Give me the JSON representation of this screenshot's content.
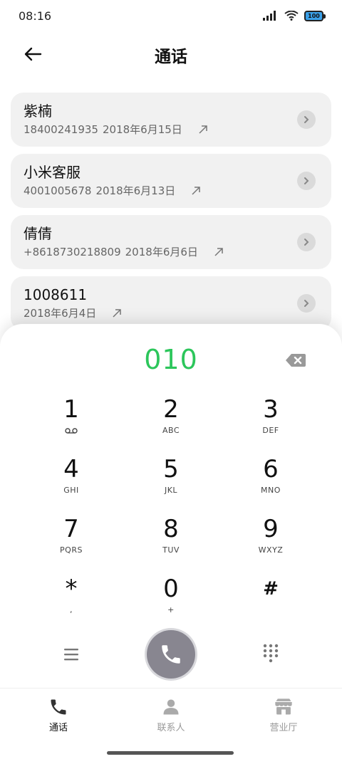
{
  "status_bar": {
    "time": "08:16",
    "battery": "100"
  },
  "header": {
    "title": "通话"
  },
  "calls": [
    {
      "name": "紫楠",
      "number": "18400241935",
      "date": "2018年6月15日"
    },
    {
      "name": "小米客服",
      "number": "4001005678",
      "date": "2018年6月13日"
    },
    {
      "name": "倩倩",
      "number": "+8618730218809",
      "date": "2018年6月6日"
    },
    {
      "name": "1008611",
      "number": "",
      "date": "2018年6月4日"
    }
  ],
  "dialer": {
    "dialed": "010",
    "keys": [
      {
        "digit": "1",
        "letters": ""
      },
      {
        "digit": "2",
        "letters": "ABC"
      },
      {
        "digit": "3",
        "letters": "DEF"
      },
      {
        "digit": "4",
        "letters": "GHI"
      },
      {
        "digit": "5",
        "letters": "JKL"
      },
      {
        "digit": "6",
        "letters": "MNO"
      },
      {
        "digit": "7",
        "letters": "PQRS"
      },
      {
        "digit": "8",
        "letters": "TUV"
      },
      {
        "digit": "9",
        "letters": "WXYZ"
      },
      {
        "digit": "*",
        "letters": ","
      },
      {
        "digit": "0",
        "letters": "+"
      },
      {
        "digit": "#",
        "letters": ""
      }
    ],
    "accent_color": "#2cc65b",
    "call_button_color": "#888690"
  },
  "bottom_nav": [
    {
      "label": "通话",
      "icon": "phone-icon",
      "active": true
    },
    {
      "label": "联系人",
      "icon": "person-icon",
      "active": false
    },
    {
      "label": "营业厅",
      "icon": "store-icon",
      "active": false
    }
  ]
}
